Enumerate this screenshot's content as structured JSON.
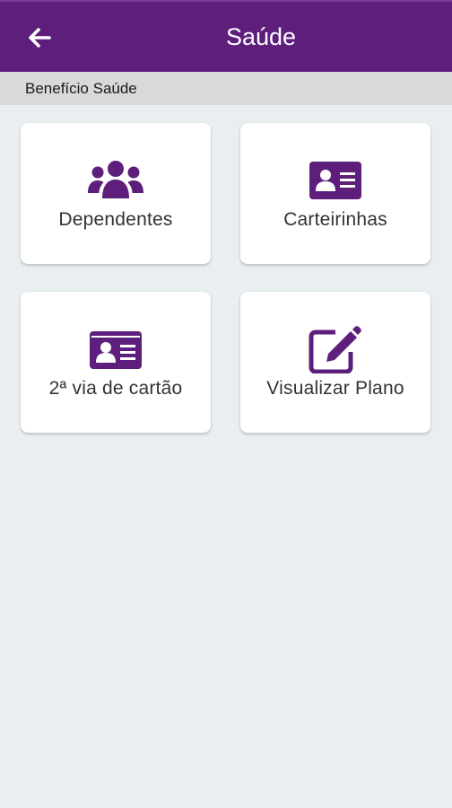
{
  "header": {
    "title": "Saúde",
    "back_icon": "arrow-left-icon",
    "background": "#5e1f7c"
  },
  "section": {
    "label": "Benefício Saúde"
  },
  "accent_color": "#5e1f7c",
  "cards": [
    {
      "label": "Dependentes",
      "icon": "users-group-icon"
    },
    {
      "label": "Carteirinhas",
      "icon": "id-card-icon"
    },
    {
      "label": "2ª via de cartão",
      "icon": "id-card-icon"
    },
    {
      "label": "Visualizar Plano",
      "icon": "edit-icon"
    }
  ]
}
